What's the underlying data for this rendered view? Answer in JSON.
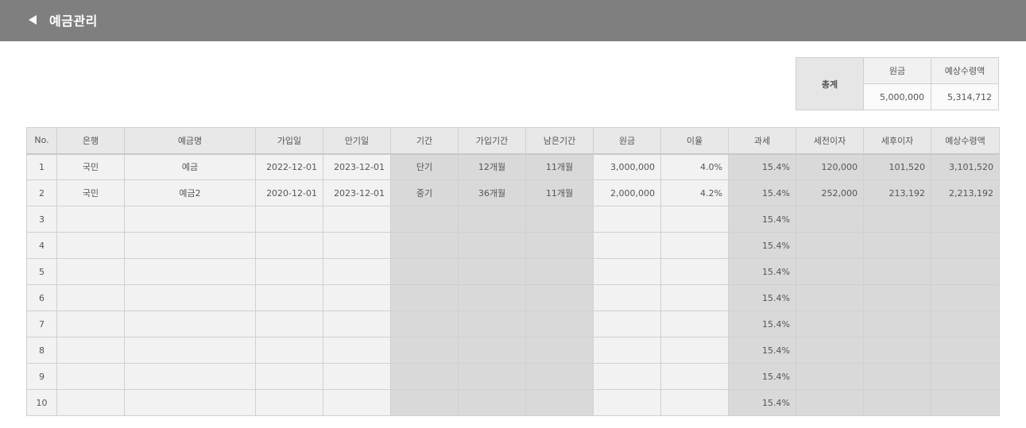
{
  "header": {
    "title": "예금관리"
  },
  "summary": {
    "label": "총계",
    "headers": [
      "원금",
      "예상수령액"
    ],
    "values": [
      "5,000,000",
      "5,314,712"
    ]
  },
  "table": {
    "columns": [
      "No.",
      "은행",
      "예금명",
      "가입일",
      "만기일",
      "기간",
      "가입기간",
      "남은기간",
      "원금",
      "이율",
      "과세",
      "세전이자",
      "세후이자",
      "예상수령액"
    ],
    "rows": [
      [
        "1",
        "국민",
        "예금",
        "2022-12-01",
        "2023-12-01",
        "단기",
        "12개월",
        "11개월",
        "3,000,000",
        "4.0%",
        "15.4%",
        "120,000",
        "101,520",
        "3,101,520"
      ],
      [
        "2",
        "국민",
        "예금2",
        "2020-12-01",
        "2023-12-01",
        "중기",
        "36개월",
        "11개월",
        "2,000,000",
        "4.2%",
        "15.4%",
        "252,000",
        "213,192",
        "2,213,192"
      ],
      [
        "3",
        "",
        "",
        "",
        "",
        "",
        "",
        "",
        "",
        "",
        "15.4%",
        "",
        "",
        ""
      ],
      [
        "4",
        "",
        "",
        "",
        "",
        "",
        "",
        "",
        "",
        "",
        "15.4%",
        "",
        "",
        ""
      ],
      [
        "5",
        "",
        "",
        "",
        "",
        "",
        "",
        "",
        "",
        "",
        "15.4%",
        "",
        "",
        ""
      ],
      [
        "6",
        "",
        "",
        "",
        "",
        "",
        "",
        "",
        "",
        "",
        "15.4%",
        "",
        "",
        ""
      ],
      [
        "7",
        "",
        "",
        "",
        "",
        "",
        "",
        "",
        "",
        "",
        "15.4%",
        "",
        "",
        ""
      ],
      [
        "8",
        "",
        "",
        "",
        "",
        "",
        "",
        "",
        "",
        "",
        "15.4%",
        "",
        "",
        ""
      ],
      [
        "9",
        "",
        "",
        "",
        "",
        "",
        "",
        "",
        "",
        "",
        "15.4%",
        "",
        "",
        ""
      ],
      [
        "10",
        "",
        "",
        "",
        "",
        "",
        "",
        "",
        "",
        "",
        "15.4%",
        "",
        "",
        ""
      ]
    ]
  }
}
